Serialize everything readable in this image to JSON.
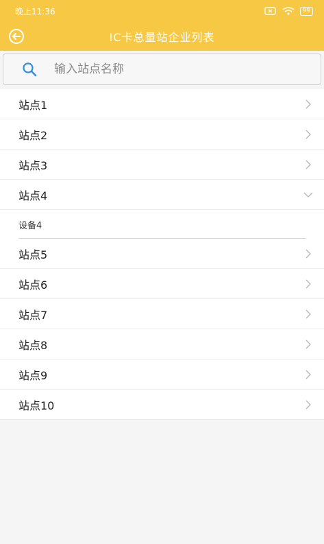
{
  "status_bar": {
    "time": "晚上11:36",
    "battery": "99"
  },
  "header": {
    "title": "IC卡总量站企业列表"
  },
  "search": {
    "placeholder": "输入站点名称"
  },
  "icons": {
    "back": "back-arrow-circle-icon",
    "search": "search-icon",
    "chevron_right": "chevron-right-icon",
    "chevron_down": "chevron-down-icon"
  },
  "colors": {
    "header": "#f7c843",
    "search_icon": "#2f8de4"
  },
  "stations": [
    {
      "label": "站点1"
    },
    {
      "label": "站点2"
    },
    {
      "label": "站点3"
    },
    {
      "label": "站点4",
      "expanded": true,
      "devices": [
        "设备4"
      ]
    },
    {
      "label": "站点5"
    },
    {
      "label": "站点6"
    },
    {
      "label": "站点7"
    },
    {
      "label": "站点8"
    },
    {
      "label": "站点9"
    },
    {
      "label": "站点10"
    }
  ]
}
